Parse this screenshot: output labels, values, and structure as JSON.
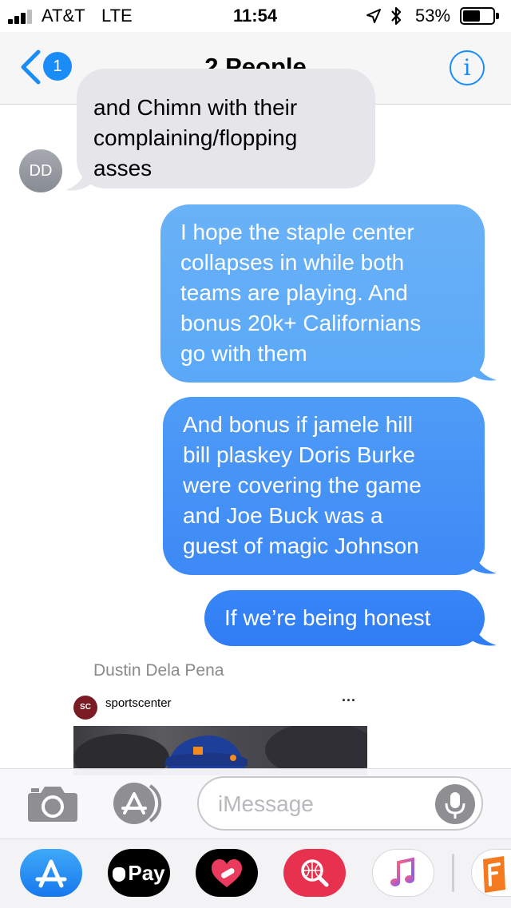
{
  "status_bar": {
    "carrier": "AT&T",
    "network": "LTE",
    "time": "11:54",
    "battery": "53%",
    "icons": [
      "location-arrow-icon",
      "bluetooth-icon",
      "battery-icon"
    ]
  },
  "nav": {
    "back_badge": "1",
    "title": "2 People",
    "info_glyph": "i"
  },
  "colors": {
    "accent": "#1a8cf8",
    "sent_top": "#6ab2f7",
    "sent_bottom": "#2f7cf5",
    "received": "#e5e5ea"
  },
  "messages": {
    "received_1": {
      "avatar_initials": "DD",
      "lines": [
        "and Chimn with their",
        "complaining/flopping",
        "asses"
      ]
    },
    "sent_1": {
      "lines": [
        "I hope the staple center",
        "collapses in while both",
        "teams are playing. And",
        "bonus 20k+ Californians",
        "go with them"
      ]
    },
    "sent_2": {
      "lines": [
        "And bonus if jamele hill",
        "bill plaskey Doris Burke",
        "were covering the game",
        "and Joe Buck was a",
        "guest of magic Johnson"
      ]
    },
    "sent_3": {
      "lines": [
        "If we’re being honest"
      ]
    }
  },
  "shared_post": {
    "sender_name": "Dustin Dela Pena",
    "logo_text": "SC",
    "username": "sportscenter",
    "more": "···"
  },
  "input_bar": {
    "placeholder": "iMessage"
  },
  "app_strip": {
    "apple_pay_label": "Pay",
    "apps": [
      "app-store-icon",
      "apple-pay-icon",
      "digital-touch-icon",
      "search-images-icon",
      "music-icon",
      "fandango-icon"
    ]
  }
}
